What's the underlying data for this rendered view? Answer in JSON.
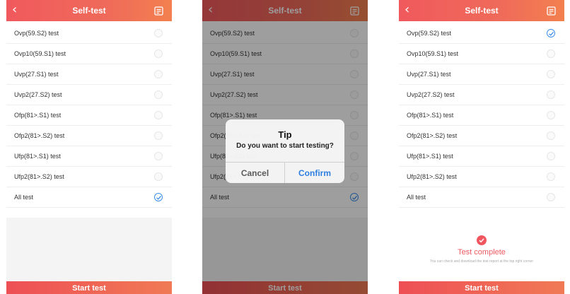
{
  "header": {
    "title": "Self-test",
    "back_glyph": "‹"
  },
  "tests": [
    "Ovp(59.S2) test",
    "Ovp10(59.S1) test",
    "Uvp(27.S1) test",
    "Uvp2(27.S2) test",
    "Ofp(81>.S1) test",
    "Ofp2(81>.S2) test",
    "Ufp(81>.S1) test",
    "Ufp2(81>.S2) test",
    "All test"
  ],
  "start_button": "Start test",
  "dialog": {
    "title": "Tip",
    "message": "Do you want to start testing?",
    "cancel": "Cancel",
    "confirm": "Confirm"
  },
  "complete": {
    "title": "Test complete",
    "note": "You can check and download the test report at the top right corner"
  },
  "colors": {
    "accent": "#f05a5b",
    "check": "#3d8ee8",
    "confirm": "#2f7fe0"
  },
  "icons": {
    "back": "chevron-left-icon",
    "report": "report-icon",
    "check": "checkmark-icon"
  }
}
